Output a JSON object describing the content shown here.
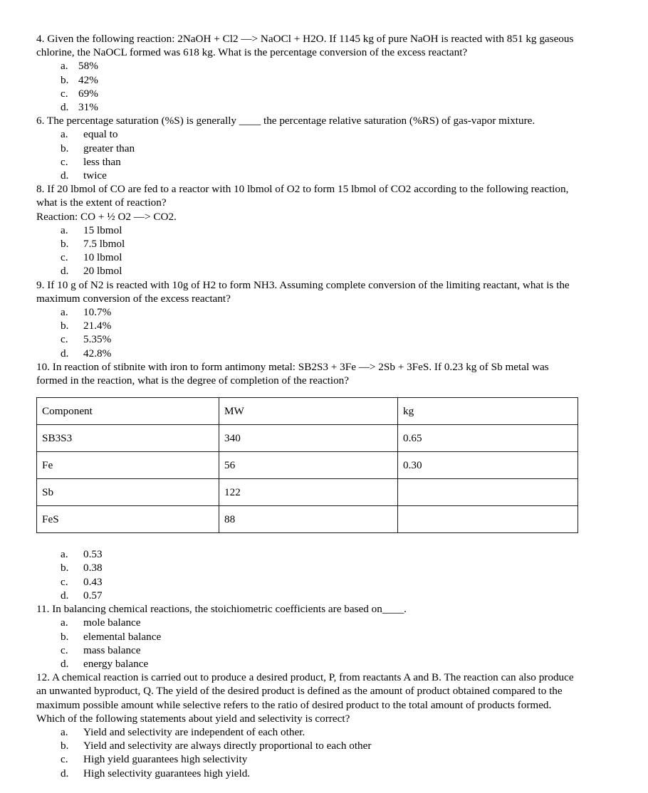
{
  "questions": [
    {
      "number": "4.",
      "stem": "4. Given the following reaction: 2NaOH + Cl2 —> NaOCl + H2O. If 1145 kg of pure NaOH is reacted with 851 kg gaseous chlorine, the NaOCL formed was 618 kg. What is the percentage conversion of the excess reactant?",
      "options": [
        {
          "letter": "a.",
          "text": "58%"
        },
        {
          "letter": "b.",
          "text": "42%"
        },
        {
          "letter": "c.",
          "text": "69%"
        },
        {
          "letter": "d.",
          "text": "31%"
        }
      ]
    },
    {
      "number": "6.",
      "stem": "6. The percentage saturation (%S) is generally ____ the percentage relative saturation (%RS) of gas-vapor mixture.",
      "options": [
        {
          "letter": "a.",
          "text": "equal to"
        },
        {
          "letter": "b.",
          "text": "greater than"
        },
        {
          "letter": "c.",
          "text": "less than"
        },
        {
          "letter": "d.",
          "text": "twice"
        }
      ]
    },
    {
      "number": "8.",
      "stem": "8. If 20 lbmol of CO are fed to a reactor with 10 lbmol of O2 to form 15 lbmol of CO2 according to the following reaction, what is the extent of reaction?",
      "stem_extra": "Reaction: CO + ½ O2 —> CO2.",
      "options": [
        {
          "letter": "a.",
          "text": "15 lbmol"
        },
        {
          "letter": "b.",
          "text": "7.5 lbmol"
        },
        {
          "letter": "c.",
          "text": "10 lbmol"
        },
        {
          "letter": "d.",
          "text": "20 lbmol"
        }
      ]
    },
    {
      "number": "9.",
      "stem": "9. If 10 g of N2 is reacted with 10g of H2 to form NH3. Assuming complete conversion of the limiting reactant, what is the maximum conversion of the excess reactant?",
      "options": [
        {
          "letter": "a.",
          "text": "10.7%"
        },
        {
          "letter": "b.",
          "text": "21.4%"
        },
        {
          "letter": "c.",
          "text": "5.35%"
        },
        {
          "letter": "d.",
          "text": "42.8%"
        }
      ]
    },
    {
      "number": "10.",
      "stem": "10. In reaction of stibnite with iron to form antimony metal: SB2S3 + 3Fe —> 2Sb + 3FeS. If 0.23 kg of Sb metal was formed in the reaction, what is the degree of completion of the reaction?",
      "options": [
        {
          "letter": "a.",
          "text": "0.53"
        },
        {
          "letter": "b.",
          "text": "0.38"
        },
        {
          "letter": "c.",
          "text": "0.43"
        },
        {
          "letter": "d.",
          "text": "0.57"
        }
      ]
    },
    {
      "number": "11.",
      "stem": "11. In balancing chemical reactions, the stoichiometric coefficients are based on____.",
      "options": [
        {
          "letter": "a.",
          "text": "mole balance"
        },
        {
          "letter": "b.",
          "text": "elemental balance"
        },
        {
          "letter": "c.",
          "text": "mass balance"
        },
        {
          "letter": "d.",
          "text": "energy balance"
        }
      ]
    },
    {
      "number": "12.",
      "stem": "12. A chemical reaction is carried out to produce a desired product, P, from reactants A and B. The reaction can also produce an unwanted byproduct, Q. The yield of the desired product is defined as the amount of product obtained compared to the maximum possible amount while selective refers to the ratio of desired product to the total amount of products formed. Which of the following statements about yield and selectivity is correct?",
      "options": [
        {
          "letter": "a.",
          "text": "Yield and selectivity are independent of each other."
        },
        {
          "letter": "b.",
          "text": "Yield and selectivity are always directly proportional to each other"
        },
        {
          "letter": "c.",
          "text": "High yield guarantees high selectivity"
        },
        {
          "letter": "d.",
          "text": "High selectivity guarantees high yield."
        }
      ]
    }
  ],
  "table": {
    "headers": [
      "Component",
      "MW",
      "kg"
    ],
    "rows": [
      [
        "SB3S3",
        "340",
        "0.65"
      ],
      [
        "Fe",
        "56",
        "0.30"
      ],
      [
        "Sb",
        "122",
        ""
      ],
      [
        "FeS",
        "88",
        ""
      ]
    ]
  }
}
